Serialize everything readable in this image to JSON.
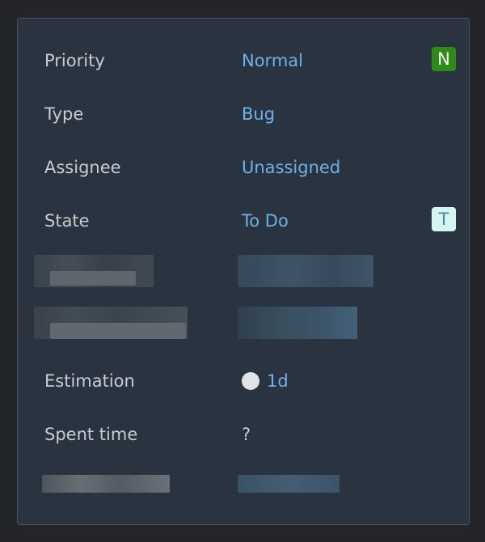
{
  "fields": {
    "priority": {
      "label": "Priority",
      "value": "Normal",
      "badge": "N"
    },
    "type": {
      "label": "Type",
      "value": "Bug"
    },
    "assignee": {
      "label": "Assignee",
      "value": "Unassigned"
    },
    "state": {
      "label": "State",
      "value": "To Do",
      "badge": "T"
    },
    "estimation": {
      "label": "Estimation",
      "value": "1d",
      "icon": "circle-icon"
    },
    "spent_time": {
      "label": "Spent time",
      "value": "?"
    }
  },
  "colors": {
    "panel_bg": "#2a3440",
    "label_text": "#c8ccd0",
    "link_text": "#6fb0e8",
    "badge_priority_bg": "#2f8a17",
    "badge_state_bg": "#d6f4f2"
  }
}
